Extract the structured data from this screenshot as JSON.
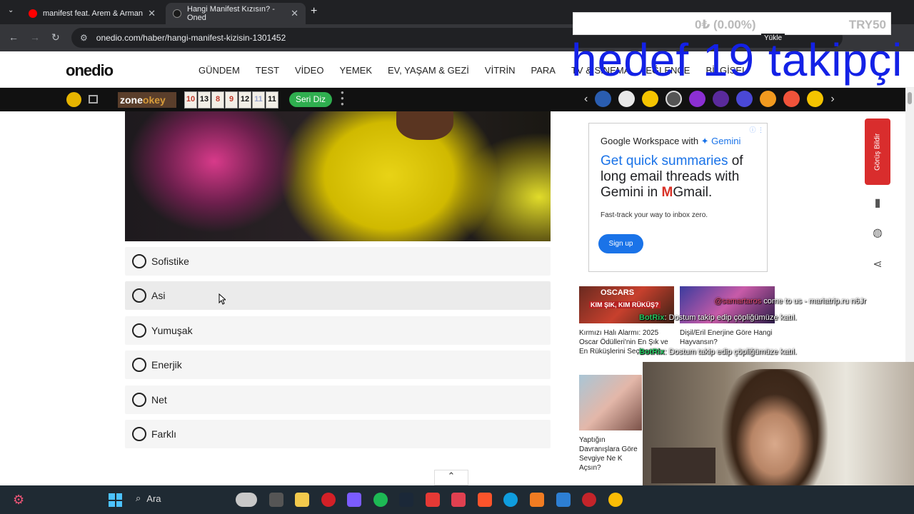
{
  "browser": {
    "tabs": [
      {
        "title": "manifest feat. Arem & Arman",
        "favicon_color": "#ff0000"
      },
      {
        "title": "Hangi Manifest Kızısın? - Oned",
        "favicon_color": "#1a1a1a"
      }
    ],
    "url": "onedio.com/haber/hangi-manifest-kizisin-1301452"
  },
  "overlay": {
    "price_change": "0₺ (0.00%)",
    "ticker": "TRY50",
    "goal_text": "hedef 19 takipçi (",
    "upload_label": "Yükle"
  },
  "site": {
    "logo": "onedio",
    "nav": [
      "GÜNDEM",
      "TEST",
      "VİDEO",
      "YEMEK",
      "EV, YAŞAM & GEZİ",
      "VİTRİN",
      "PARA",
      "TV & SİNEMA",
      "EĞLENCE",
      "BİLGİSEL"
    ]
  },
  "extbar": {
    "zone_label_a": "zone",
    "zone_label_b": "okey",
    "tiles": [
      "10",
      "13",
      "8",
      "9",
      "12",
      "11",
      "11"
    ],
    "seri_label": "Seri Diz"
  },
  "quiz": {
    "options": [
      "Sofistike",
      "Asi",
      "Yumuşak",
      "Enerjik",
      "Net",
      "Farklı"
    ]
  },
  "ad": {
    "brand_a": "Google Workspace with ",
    "brand_b": "✦ Gemini",
    "headline_a": "Get quick summaries",
    "headline_b": " of long email threads with Gemini in ",
    "headline_m": "M",
    "headline_c": "Gmail.",
    "sub": "Fast-track your way to inbox zero.",
    "cta": "Sign up"
  },
  "cards": [
    {
      "label": "KIM ŞIK, KIM RÜKÜŞ?",
      "label2": "OSCARS",
      "title": "Kırmızı Halı Alarmı: 2025 Oscar Ödülleri'nin En Şık ve En Rüküşlerini Seçiyoruz!"
    },
    {
      "label": "",
      "label2": "",
      "title": "Dişil/Eril Enerjine Göre Hangi Hayvansın?"
    },
    {
      "label": "",
      "label2": "",
      "title": "Yaptığın Davranışlara Göre Sevgiye Ne K Açsın?"
    }
  ],
  "chat": [
    {
      "user": "@samartaros",
      "msg": "come to us - mariatrip.ru n6Jr"
    },
    {
      "user": "BotRix",
      "msg": "Dostum takip edip çöpliğümüze katıl."
    },
    {
      "user": "BotRix",
      "msg": "Dostum takip edip çöpliğümüze katıl."
    }
  ],
  "sidebar": {
    "feedback_label": "Görüş Bildir"
  },
  "taskbar": {
    "search_label": "Ara"
  }
}
